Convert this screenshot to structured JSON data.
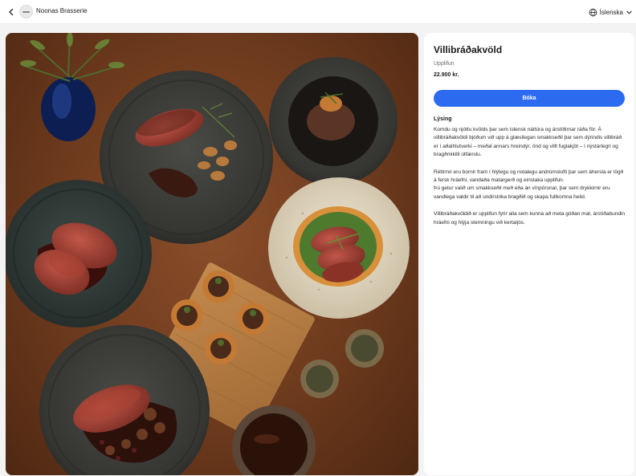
{
  "header": {
    "restaurant_name": "Noonas Brasserie",
    "language": "Íslenska",
    "back_icon": "chevron-left-icon",
    "globe_icon": "globe-icon",
    "dropdown_icon": "chevron-down-icon"
  },
  "product": {
    "title": "Villibráðakvöld",
    "category": "Upplifun",
    "price": "22.900 kr.",
    "book_label": "Bóka",
    "description_heading": "Lýsing",
    "paragraphs": [
      "Komdu og njóttu kvölds þar sem íslensk náttúra og árstíðirnar ráða för. Á villibráðakvöldi bjóðum við upp á glæsilegan smakkseðil þar sem dýrindis villibráð er í aðalhlutverki – meðal annars hreindýr, önd og villt fuglakjöt – í nýstárlegri og bragðmikilli útfærslu.",
      "Réttirnir eru bornir fram í hlýlegu og notalegu andrúmslofti þar sem áhersla er lögð á fersk hráefni, vandaða matargerð og einstaka upplifun.",
      "Þú getur valið um smakkseðil með eða án vínpörunar, þar sem drykkirnir eru vandlega valdir til að undirstrika bragðið og skapa fullkomna heild.",
      "Villibráðakvöldið er upplifun fyrir alla sem kunna að meta góðan mat, árstíðabundin hráefni og hlýja stemningu við kertaljós."
    ]
  },
  "colors": {
    "accent": "#2c6bf0",
    "table_wood": "#6d3a1d",
    "card_bg": "#ffffff",
    "page_bg": "#f3f3f4"
  }
}
